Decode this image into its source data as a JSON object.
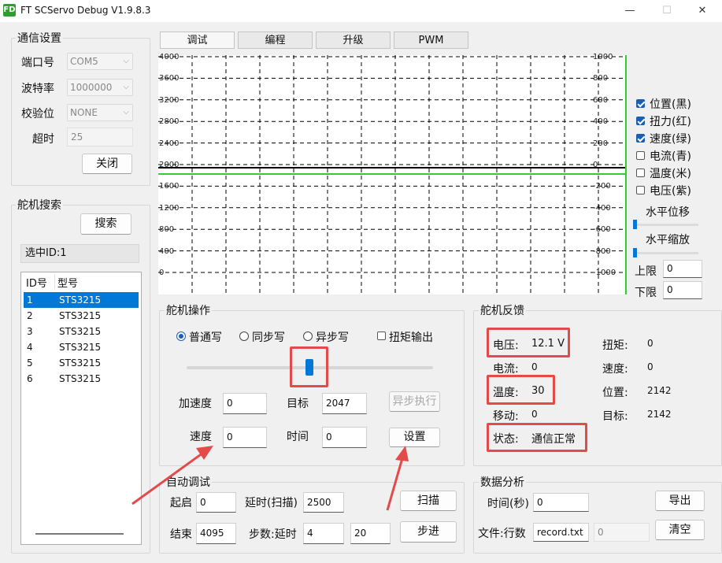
{
  "window": {
    "title": "FT SCServo Debug V1.9.8.3",
    "icon_text": "FD",
    "min_symbol": "—",
    "max_symbol": "☐",
    "close_symbol": "✕"
  },
  "comm": {
    "title": "通信设置",
    "port_label": "端口号",
    "port_value": "COM5",
    "baud_label": "波特率",
    "baud_value": "1000000",
    "parity_label": "校验位",
    "parity_value": "NONE",
    "timeout_label": "超时",
    "timeout_value": "25",
    "close_button": "关闭"
  },
  "search": {
    "title": "舵机搜索",
    "search_button": "搜索",
    "selected_label": "选中ID:1",
    "columns": [
      "ID号",
      "型号"
    ],
    "rows": [
      {
        "id": "1",
        "model": "STS3215"
      },
      {
        "id": "2",
        "model": "STS3215"
      },
      {
        "id": "3",
        "model": "STS3215"
      },
      {
        "id": "4",
        "model": "STS3215"
      },
      {
        "id": "5",
        "model": "STS3215"
      },
      {
        "id": "6",
        "model": "STS3215"
      }
    ],
    "selected_index": 0
  },
  "tabs": [
    "调试",
    "编程",
    "升级",
    "PWM"
  ],
  "active_tab": 0,
  "plot": {
    "left_ticks": [
      "4000",
      "3600",
      "3200",
      "2800",
      "2400",
      "2000",
      "1600",
      "1200",
      "800",
      "400",
      "0"
    ],
    "right_ticks": [
      "1000",
      "800",
      "600",
      "400",
      "200",
      "0",
      "-200",
      "-400",
      "-600",
      "-800",
      "-1000"
    ],
    "series_colors": {
      "position": "#000000",
      "speed": "#33cc33"
    }
  },
  "legend": {
    "items": [
      {
        "label": "位置(黑)",
        "checked": true
      },
      {
        "label": "扭力(红)",
        "checked": true
      },
      {
        "label": "速度(绿)",
        "checked": true
      },
      {
        "label": "电流(青)",
        "checked": false
      },
      {
        "label": "温度(米)",
        "checked": false
      },
      {
        "label": "电压(紫)",
        "checked": false
      }
    ],
    "h_offset_label": "水平位移",
    "h_zoom_label": "水平缩放",
    "upper_label": "上限",
    "upper_value": "0",
    "lower_label": "下限",
    "lower_value": "0"
  },
  "servo_op": {
    "title": "舵机操作",
    "modes": [
      "普通写",
      "同步写",
      "异步写"
    ],
    "mode_selected": 0,
    "torque_label": "扭矩输出",
    "torque_checked": false,
    "slider_value_fraction": 0.5,
    "accel_label": "加速度",
    "accel_value": "0",
    "target_label": "目标",
    "target_value": "2047",
    "async_exec_button": "异步执行",
    "speed_label": "速度",
    "speed_value": "0",
    "time_label": "时间",
    "time_value": "0",
    "set_button": "设置"
  },
  "feedback": {
    "title": "舵机反馈",
    "voltage_label": "电压:",
    "voltage_value": "12.1 V",
    "torque_label": "扭矩:",
    "torque_value": "0",
    "current_label": "电流:",
    "current_value": "0",
    "speed_label": "速度:",
    "speed_value": "0",
    "temp_label": "温度:",
    "temp_value": "30",
    "position_label": "位置:",
    "position_value": "2142",
    "move_label": "移动:",
    "move_value": "0",
    "target_label": "目标:",
    "target_value": "2142",
    "status_label": "状态:",
    "status_value": "通信正常"
  },
  "auto_debug": {
    "title": "自动调试",
    "start_label": "起启",
    "start_value": "0",
    "delay_scan_label": "延时(扫描)",
    "delay_scan_value": "2500",
    "scan_button": "扫描",
    "end_label": "结束",
    "end_value": "4095",
    "step_delay_label": "步数:延时",
    "step_value": "4",
    "delay_value": "20",
    "step_button": "步进"
  },
  "data_analysis": {
    "title": "数据分析",
    "time_label": "时间(秒)",
    "time_value": "0",
    "export_button": "导出",
    "file_label": "文件:行数",
    "file_value": "record.txt",
    "rows_value": "0",
    "clear_button": "清空"
  },
  "colors": {
    "accent": "#0078d7",
    "highlight_red": "#e34a4a",
    "speed_line": "#33cc33"
  }
}
